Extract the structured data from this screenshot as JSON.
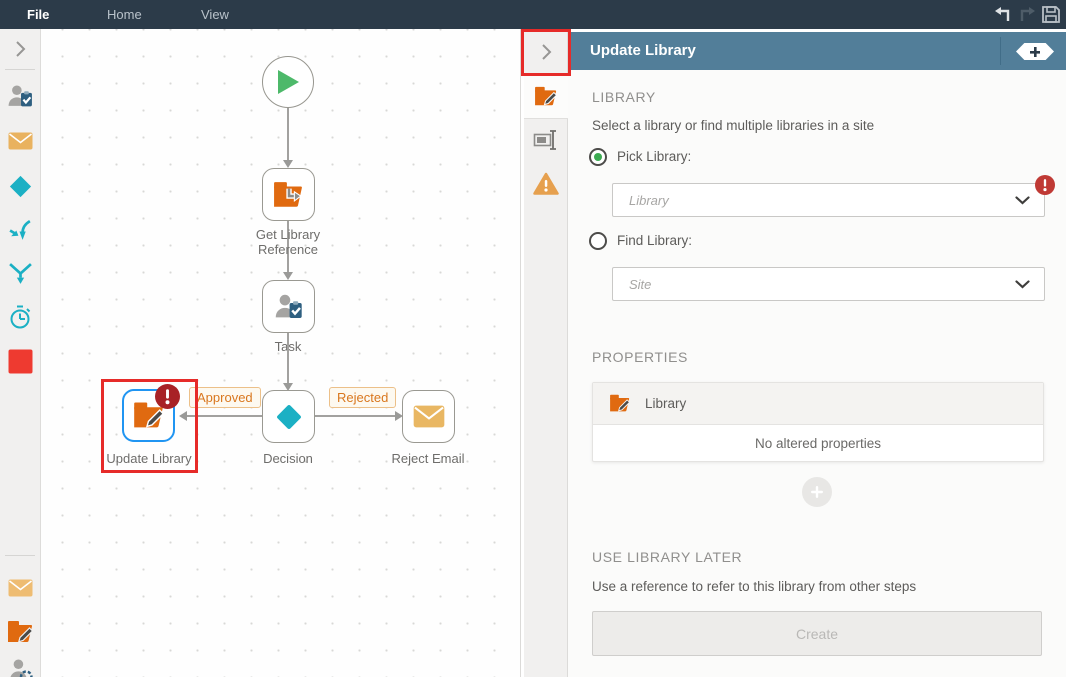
{
  "window": {
    "menu": [
      "File",
      "Home",
      "View"
    ]
  },
  "left_toolbar": {
    "icons": [
      "expand-chevron",
      "user-task",
      "send-email",
      "decision",
      "merge",
      "split",
      "timer",
      "placeholder",
      "send-email-2",
      "update-library",
      "user-event"
    ]
  },
  "canvas": {
    "nodes": [
      {
        "key": "start",
        "label": ""
      },
      {
        "key": "get-library-reference",
        "label": "Get Library Reference"
      },
      {
        "key": "task",
        "label": "Task"
      },
      {
        "key": "decision",
        "label": "Decision"
      },
      {
        "key": "update-library",
        "label": "Update Library"
      },
      {
        "key": "reject-email",
        "label": "Reject Email"
      }
    ],
    "branches": {
      "approved": "Approved",
      "rejected": "Rejected"
    }
  },
  "panel": {
    "title": "Update Library",
    "library": {
      "header": "LIBRARY",
      "description": "Select a library or find multiple libraries in a site",
      "pick_label": "Pick Library:",
      "library_placeholder": "Library",
      "find_label": "Find Library:",
      "site_placeholder": "Site"
    },
    "properties": {
      "header": "PROPERTIES",
      "item": "Library",
      "empty": "No altered properties"
    },
    "use_later": {
      "header": "USE LIBRARY LATER",
      "description": "Use a reference to refer to this library from other steps",
      "create": "Create"
    }
  },
  "colors": {
    "menu_bar": "#2c3b49",
    "panel_header": "#527e99",
    "orange": "#e06a10",
    "amber": "#e9b25f",
    "teal": "#1bb0c4",
    "green": "#4db96a",
    "red_square": "#ee3a30",
    "error_red": "#a82226",
    "field_error_red": "#c03a35",
    "selection_blue": "#2095f2",
    "annotation_red": "#e62b29"
  }
}
